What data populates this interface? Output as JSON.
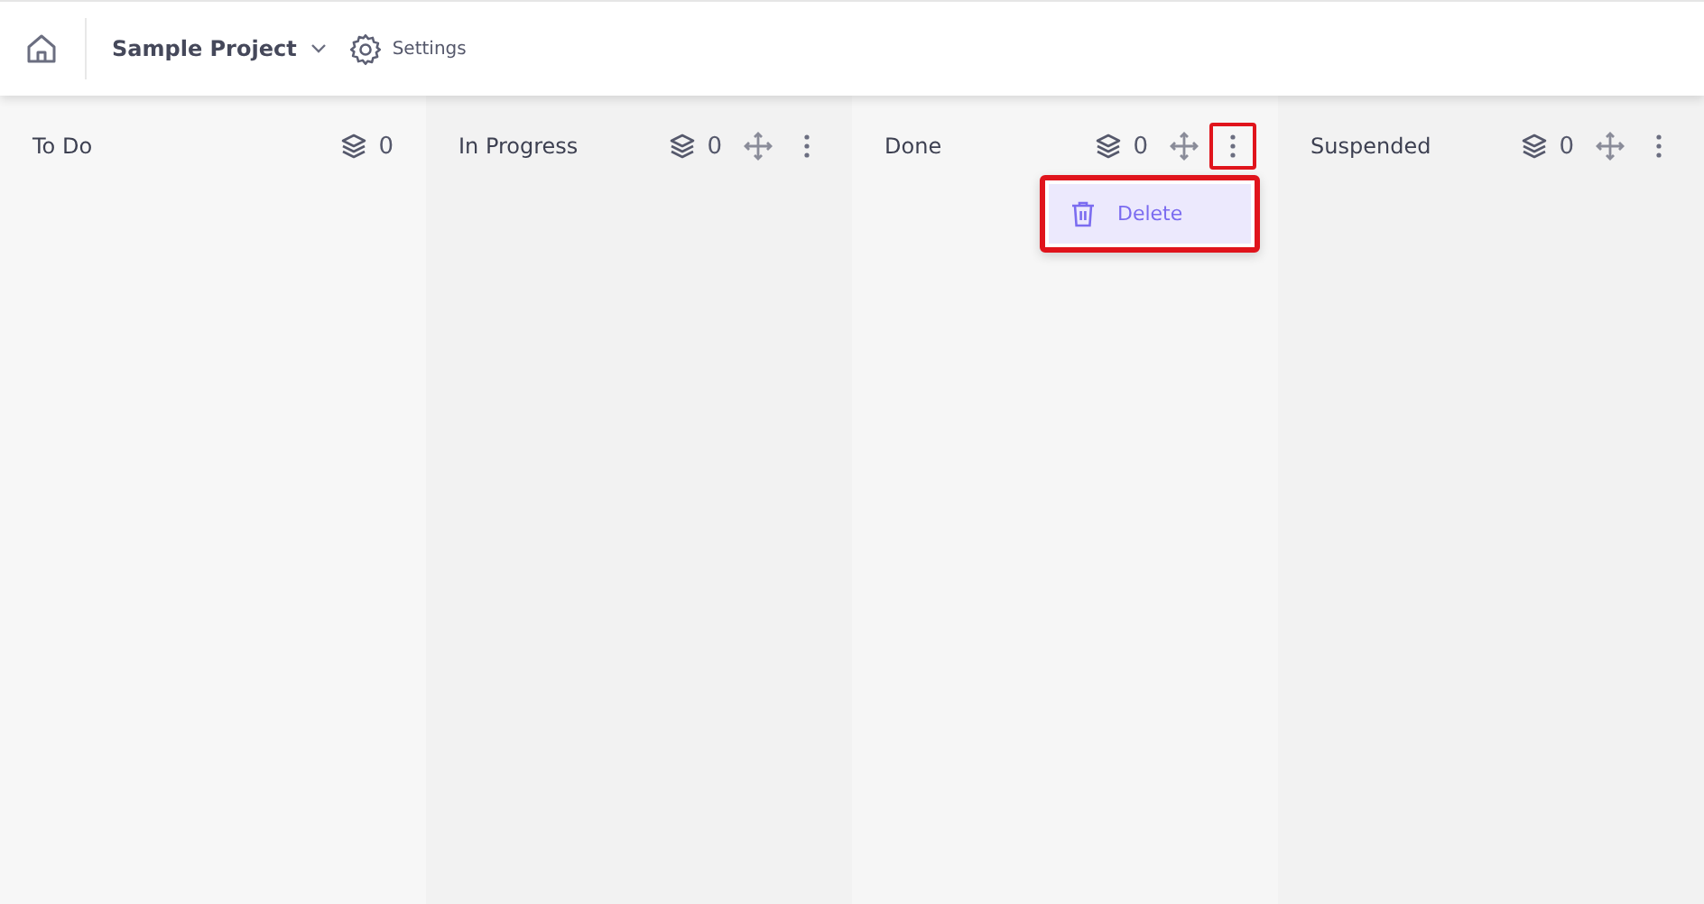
{
  "header": {
    "project": "Sample Project",
    "settings": "Settings"
  },
  "columns": [
    {
      "title": "To Do",
      "count": "0"
    },
    {
      "title": "In Progress",
      "count": "0",
      "actions": [
        {
          "kind": "move"
        },
        {
          "kind": "more",
          "highlighted": false
        }
      ]
    },
    {
      "title": "Done",
      "count": "0",
      "actions": [
        {
          "kind": "move"
        },
        {
          "kind": "more",
          "highlighted": true
        }
      ],
      "menu": {
        "highlighted": true,
        "items": [
          {
            "label": "Delete",
            "selected": true
          }
        ]
      }
    },
    {
      "title": "Suspended",
      "count": "0",
      "actions": [
        {
          "kind": "move"
        },
        {
          "kind": "more",
          "highlighted": false
        }
      ]
    }
  ]
}
